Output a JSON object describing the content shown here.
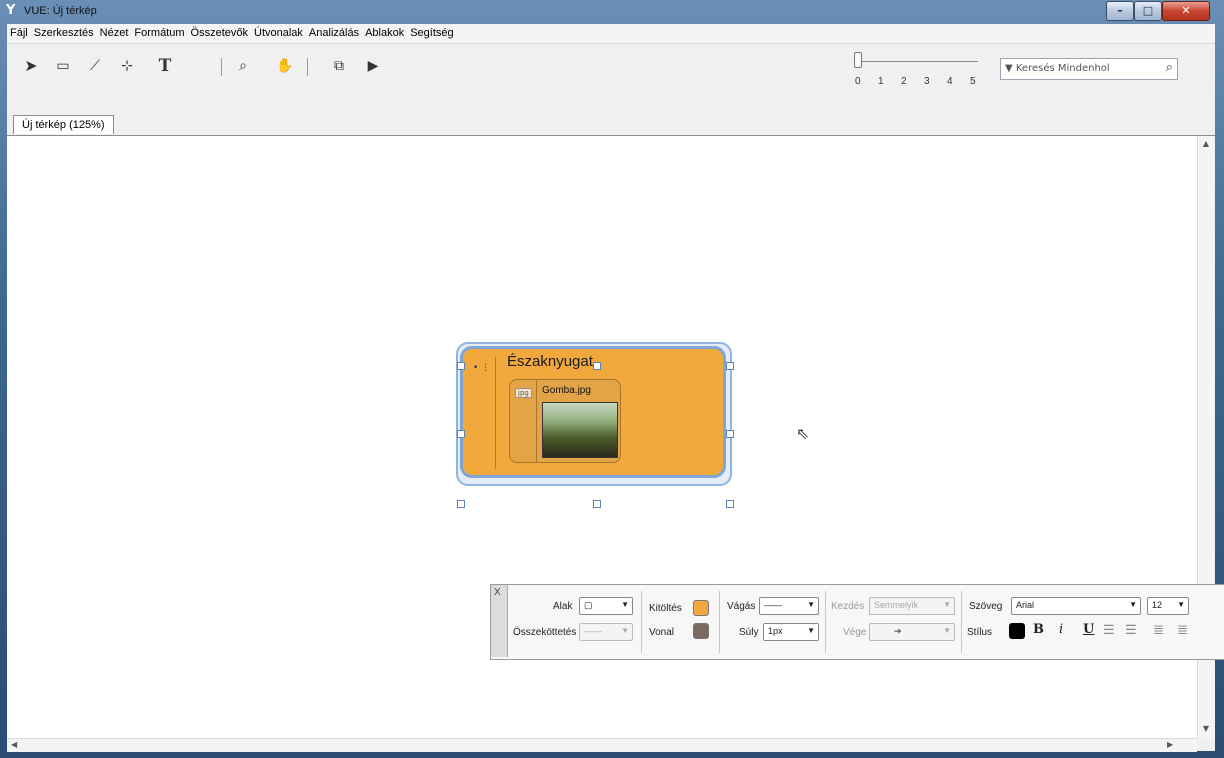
{
  "window": {
    "title": "VUE: Új térkép",
    "app_icon": "vue-logo-icon",
    "controls": [
      "minimize-icon",
      "maximize-icon",
      "close-icon"
    ]
  },
  "menu": [
    "Fájl",
    "Szerkesztés",
    "Nézet",
    "Formátum",
    "Összetevők",
    "Útvonalak",
    "Analizálás",
    "Ablakok",
    "Segítség"
  ],
  "toolbar": {
    "tools": [
      "select-arrow-icon",
      "node-rectangle-icon",
      "link-line-icon",
      "curved-link-icon",
      "text-tool-icon",
      "zoom-icon",
      "pan-hand-icon",
      "slide-icon",
      "play-icon"
    ],
    "zoom_ticks": [
      "0",
      "1",
      "2",
      "3",
      "4",
      "5"
    ],
    "zoom_level": 0,
    "search_placeholder": "▼ Keresés Mindenhol"
  },
  "tabs": [
    "Új térkép (125%)"
  ],
  "node": {
    "title": "Északnyugat",
    "resource": {
      "type_tag": "jpg",
      "filename": "Gomba.jpg"
    },
    "fill_color": "#f1a93e",
    "selected": true
  },
  "format_panel": {
    "close": "X",
    "shape_label": "Alak",
    "connection_label": "Összeköttetés",
    "fill_label": "Kitöltés",
    "fill_color": "#f1a93e",
    "line_label": "Vonal",
    "line_color": "#7a6a62",
    "cut_label": "Vágás",
    "weight_label": "Súly",
    "weight_value": "1px",
    "start_label": "Kezdés",
    "start_value": "Semmelyik",
    "end_label": "Vége",
    "text_label": "Szöveg",
    "font_value": "Arial",
    "font_size": "12",
    "style_label": "Stílus",
    "style_buttons": {
      "bold": "B",
      "italic": "i",
      "underline": "U"
    }
  }
}
